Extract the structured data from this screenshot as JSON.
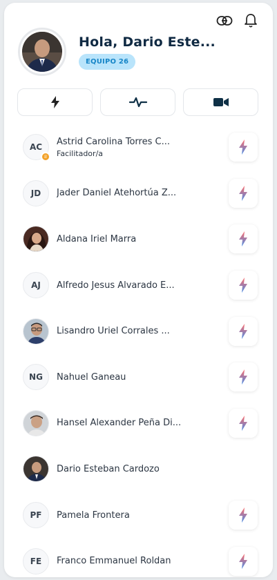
{
  "header": {
    "greeting": "Hola, Dario Este...",
    "team_badge": "EQUIPO 26",
    "icons": [
      "link-icon",
      "bell-icon"
    ]
  },
  "actions": [
    {
      "icon": "lightning-icon"
    },
    {
      "icon": "activity-icon"
    },
    {
      "icon": "video-camera-icon"
    }
  ],
  "members": [
    {
      "initials": "AC",
      "name": "Astrid Carolina Torres C...",
      "role": "Facilitador/a",
      "has_role_badge": true,
      "photo": false,
      "zap": true
    },
    {
      "initials": "JD",
      "name": "Jader Daniel Atehortúa Z...",
      "role": "",
      "has_role_badge": false,
      "photo": false,
      "zap": true
    },
    {
      "initials": "",
      "name": "Aldana Iriel Marra",
      "role": "",
      "has_role_badge": false,
      "photo": true,
      "zap": true
    },
    {
      "initials": "AJ",
      "name": "Alfredo Jesus Alvarado E...",
      "role": "",
      "has_role_badge": false,
      "photo": false,
      "zap": true
    },
    {
      "initials": "",
      "name": "Lisandro Uriel Corrales ...",
      "role": "",
      "has_role_badge": false,
      "photo": true,
      "zap": true
    },
    {
      "initials": "NG",
      "name": "Nahuel Ganeau",
      "role": "",
      "has_role_badge": false,
      "photo": false,
      "zap": true
    },
    {
      "initials": "",
      "name": "Hansel Alexander Peña Di...",
      "role": "",
      "has_role_badge": false,
      "photo": true,
      "zap": true
    },
    {
      "initials": "",
      "name": "Dario Esteban Cardozo",
      "role": "",
      "has_role_badge": false,
      "photo": true,
      "zap": false
    },
    {
      "initials": "PF",
      "name": "Pamela Frontera",
      "role": "",
      "has_role_badge": false,
      "photo": false,
      "zap": true
    },
    {
      "initials": "FE",
      "name": "Franco Emmanuel Roldan",
      "role": "",
      "has_role_badge": false,
      "photo": false,
      "zap": true
    }
  ],
  "colors": {
    "title": "#102a43",
    "badge_bg": "#b9e4fb",
    "badge_text": "#1685c7",
    "zap_gradient_start": "#ff6b6b",
    "zap_gradient_end": "#4a8fe7",
    "role_badge": "#f2a026"
  }
}
